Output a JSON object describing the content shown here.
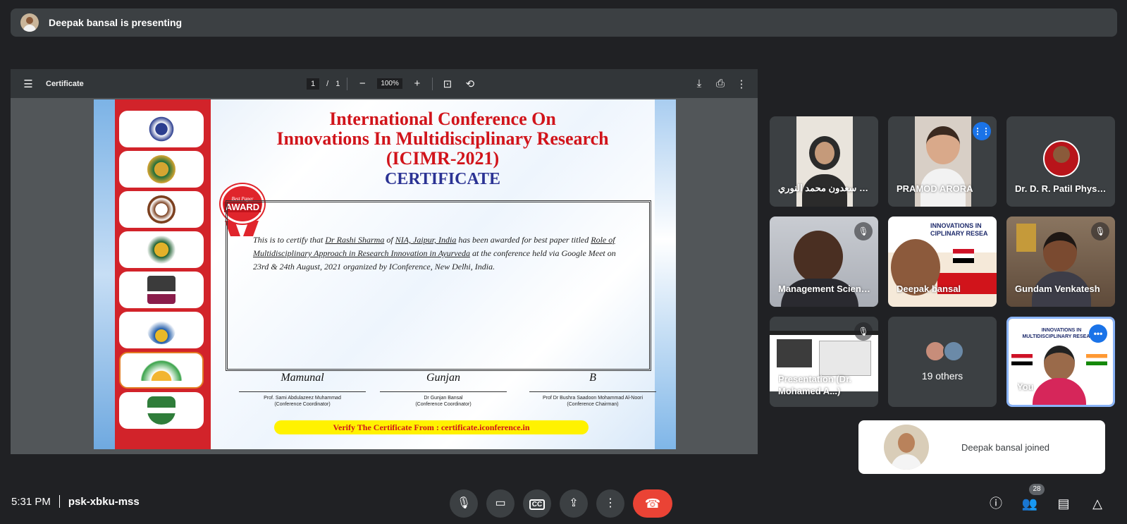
{
  "presenting_bar": {
    "text": "Deepak bansal is presenting"
  },
  "pdf": {
    "title": "Certificate",
    "page_current": "1",
    "page_total": "1",
    "page_sep": "/",
    "zoom": "100%",
    "minus": "−",
    "plus": "+"
  },
  "certificate": {
    "title_lines": [
      "International Conference On",
      "Innovations In  Multidisciplinary Research",
      "(ICIMR-2021)"
    ],
    "heading": "CERTIFICATE",
    "award_small": "Best Paper",
    "award_big": "AWARD",
    "body_prefix": "This is to certify that ",
    "recipient": "Dr Rashi Sharma",
    "body_of": " of ",
    "institution": "NIA, Jaipur, India",
    "body_mid": " has been awarded for best paper titled ",
    "paper_title": "Role of Multidisciplinary Approach in Research Innovation in Ayurveda",
    "body_suffix": " at the conference held via Google Meet on 23rd & 24th August, 2021 organized by IConference, New Delhi, India.",
    "signatures": [
      {
        "script": "Mamunal",
        "name": "Prof. Sami Abdulazeez Muhammad",
        "role": "(Conference Coordinator)"
      },
      {
        "script": "Gunjan",
        "name": "Dr Gunjan Bansal",
        "role": "(Conference Coordinator)"
      },
      {
        "script": "B",
        "name": "Prof Dr Bushra Saadoon Mohammad Al-Noori",
        "role": "(Conference Chairman)"
      }
    ],
    "verify": "Verify The Certificate From : certificate.iconference.in"
  },
  "participants": [
    {
      "name": "ی سعدون محمد النوري..."
    },
    {
      "name": "PRAMOD ARORA"
    },
    {
      "name": "Dr. D. R. Patil Physics"
    },
    {
      "name": "Management Science"
    },
    {
      "name": "Deepak bansal"
    },
    {
      "name": "Gundam Venkatesh"
    },
    {
      "name": "Presentation (Dr. Mohamed A...)"
    },
    {
      "name": "19 others"
    },
    {
      "name": "You"
    }
  ],
  "toast": {
    "text": "Deepak bansal joined"
  },
  "footer": {
    "time": "5:31 PM",
    "meeting_code": "psk-xbku-mss",
    "cc_label": "CC",
    "people_count": "28"
  },
  "colors": {
    "end_call": "#ea4335",
    "speaking": "#1a73e8",
    "active_tile_border": "#8ab4f8"
  }
}
